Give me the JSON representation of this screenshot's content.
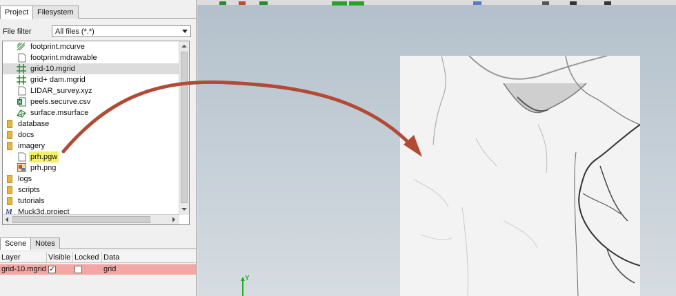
{
  "project_panel": {
    "tabs": [
      {
        "label": "Project",
        "active": true
      },
      {
        "label": "Filesystem",
        "active": false
      }
    ],
    "file_filter_label": "File filter",
    "file_filter_value": "All files (*.*)",
    "tree": [
      {
        "label": "footprint.mcurve",
        "icon": "curve-file-icon",
        "type": "file"
      },
      {
        "label": "footprint.mdrawable",
        "icon": "blank-file-icon",
        "type": "file"
      },
      {
        "label": "grid-10.mgrid",
        "icon": "grid-file-icon",
        "type": "file",
        "selected": true
      },
      {
        "label": "grid+ dam.mgrid",
        "icon": "grid-file-icon",
        "type": "file"
      },
      {
        "label": "LIDAR_survey.xyz",
        "icon": "blank-file-icon",
        "type": "file"
      },
      {
        "label": "peels.securve.csv",
        "icon": "spreadsheet-icon",
        "type": "file"
      },
      {
        "label": "surface.msurface",
        "icon": "surface-file-icon",
        "type": "file"
      },
      {
        "label": "database",
        "icon": "folder-icon",
        "type": "folder"
      },
      {
        "label": "docs",
        "icon": "folder-icon",
        "type": "folder"
      },
      {
        "label": "imagery",
        "icon": "folder-icon",
        "type": "folder"
      },
      {
        "label": "prh.pgw",
        "icon": "blank-file-icon",
        "type": "file",
        "highlighted": true
      },
      {
        "label": "prh.png",
        "icon": "image-file-icon",
        "type": "file"
      },
      {
        "label": "logs",
        "icon": "folder-icon",
        "type": "folder"
      },
      {
        "label": "scripts",
        "icon": "folder-icon",
        "type": "folder"
      },
      {
        "label": "tutorials",
        "icon": "folder-icon",
        "type": "folder"
      },
      {
        "label": "Muck3d.project",
        "icon": "project-file-icon",
        "type": "file"
      }
    ]
  },
  "scene_panel": {
    "tabs": [
      {
        "label": "Scene",
        "active": true
      },
      {
        "label": "Notes",
        "active": false
      }
    ],
    "columns": [
      "Layer",
      "Visible",
      "Locked",
      "Data"
    ],
    "rows": [
      {
        "layer": "grid-10.mgrid",
        "visible": true,
        "locked": false,
        "data": "grid"
      }
    ]
  },
  "viewport": {
    "axis_label": "Y",
    "annotation": "red-arrow-pointing-from-prh.pgw-to-terrain",
    "colors": {
      "background_top": "#b3c0cb",
      "background_bottom": "#d6dce1",
      "arrow": "#b24a35",
      "highlight": "#f4f160",
      "selected_row": "#f4a6a6"
    }
  }
}
